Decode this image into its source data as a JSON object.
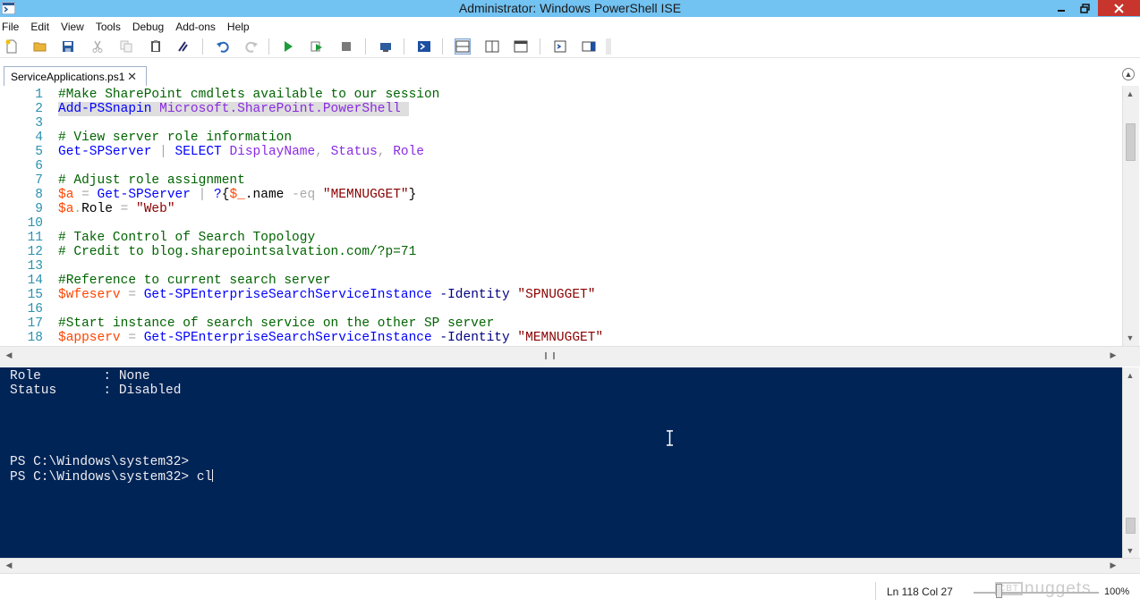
{
  "window": {
    "title": "Administrator: Windows PowerShell ISE",
    "icons": {
      "app": "powershell-ise-icon",
      "minimize": "minimize-icon",
      "maximize": "restore-icon",
      "close": "close-icon"
    }
  },
  "menubar": {
    "items": [
      "File",
      "Edit",
      "View",
      "Tools",
      "Debug",
      "Add-ons",
      "Help"
    ]
  },
  "toolbar": {
    "buttons": [
      "new-file-icon",
      "open-icon",
      "save-icon",
      "cut-icon",
      "copy-icon",
      "paste-icon",
      "clear-console-icon",
      "undo-icon",
      "redo-icon",
      "run-script-icon",
      "run-selection-icon",
      "stop-icon",
      "new-remote-tab-icon",
      "start-powershell-icon",
      "show-script-top-icon",
      "show-script-right-icon",
      "show-script-maximized-icon",
      "show-command-window-icon",
      "show-command-addon-icon"
    ]
  },
  "tabs": [
    {
      "label": "ServiceApplications.ps1",
      "close": "✕",
      "active": true
    }
  ],
  "editor": {
    "line_numbers": [
      "1",
      "2",
      "3",
      "4",
      "5",
      "6",
      "7",
      "8",
      "9",
      "10",
      "11",
      "12",
      "13",
      "14",
      "15",
      "16",
      "17",
      "18"
    ],
    "lines": [
      [
        {
          "t": "#Make SharePoint cmdlets available to our session",
          "c": "comment"
        }
      ],
      [
        {
          "t": "Add-PSSnapin",
          "c": "cmd",
          "sel": true
        },
        {
          "t": " ",
          "c": "plain",
          "sel": true
        },
        {
          "t": "Microsoft.SharePoint.PowerShell",
          "c": "arg",
          "sel": true
        },
        {
          "t": " ",
          "c": "plain",
          "sel": true
        }
      ],
      [],
      [
        {
          "t": "# View server role information",
          "c": "comment"
        }
      ],
      [
        {
          "t": "Get-SPServer",
          "c": "cmd"
        },
        {
          "t": " ",
          "c": "plain"
        },
        {
          "t": "|",
          "c": "op"
        },
        {
          "t": " ",
          "c": "plain"
        },
        {
          "t": "SELECT",
          "c": "cmd"
        },
        {
          "t": " ",
          "c": "plain"
        },
        {
          "t": "DisplayName",
          "c": "arg"
        },
        {
          "t": ",",
          "c": "op"
        },
        {
          "t": " ",
          "c": "plain"
        },
        {
          "t": "Status",
          "c": "arg"
        },
        {
          "t": ",",
          "c": "op"
        },
        {
          "t": " ",
          "c": "plain"
        },
        {
          "t": "Role",
          "c": "arg"
        }
      ],
      [],
      [
        {
          "t": "# Adjust role assignment",
          "c": "comment"
        }
      ],
      [
        {
          "t": "$a",
          "c": "var"
        },
        {
          "t": " ",
          "c": "plain"
        },
        {
          "t": "=",
          "c": "op"
        },
        {
          "t": " ",
          "c": "plain"
        },
        {
          "t": "Get-SPServer",
          "c": "cmd"
        },
        {
          "t": " ",
          "c": "plain"
        },
        {
          "t": "|",
          "c": "op"
        },
        {
          "t": " ",
          "c": "plain"
        },
        {
          "t": "?",
          "c": "cmd"
        },
        {
          "t": "{",
          "c": "plain"
        },
        {
          "t": "$_",
          "c": "var"
        },
        {
          "t": ".name",
          "c": "plain"
        },
        {
          "t": " ",
          "c": "plain"
        },
        {
          "t": "-eq",
          "c": "op"
        },
        {
          "t": " ",
          "c": "plain"
        },
        {
          "t": "\"MEMNUGGET\"",
          "c": "str"
        },
        {
          "t": "}",
          "c": "plain"
        }
      ],
      [
        {
          "t": "$a",
          "c": "var"
        },
        {
          "t": ".",
          "c": "op"
        },
        {
          "t": "Role",
          "c": "plain"
        },
        {
          "t": " ",
          "c": "plain"
        },
        {
          "t": "=",
          "c": "op"
        },
        {
          "t": " ",
          "c": "plain"
        },
        {
          "t": "\"Web\"",
          "c": "str"
        }
      ],
      [],
      [
        {
          "t": "# Take Control of Search Topology",
          "c": "comment"
        }
      ],
      [
        {
          "t": "# Credit to blog.sharepointsalvation.com/?p=71",
          "c": "comment"
        }
      ],
      [],
      [
        {
          "t": "#Reference to current search server",
          "c": "comment"
        }
      ],
      [
        {
          "t": "$wfeserv",
          "c": "var"
        },
        {
          "t": " ",
          "c": "plain"
        },
        {
          "t": "=",
          "c": "op"
        },
        {
          "t": " ",
          "c": "plain"
        },
        {
          "t": "Get-SPEnterpriseSearchServiceInstance",
          "c": "cmd"
        },
        {
          "t": " ",
          "c": "plain"
        },
        {
          "t": "-Identity",
          "c": "param"
        },
        {
          "t": " ",
          "c": "plain"
        },
        {
          "t": "\"SPNUGGET\"",
          "c": "str"
        }
      ],
      [],
      [
        {
          "t": "#Start instance of search service on the other SP server",
          "c": "comment"
        }
      ],
      [
        {
          "t": "$appserv",
          "c": "var"
        },
        {
          "t": " ",
          "c": "plain"
        },
        {
          "t": "=",
          "c": "op"
        },
        {
          "t": " ",
          "c": "plain"
        },
        {
          "t": "Get-SPEnterpriseSearchServiceInstance",
          "c": "cmd"
        },
        {
          "t": " ",
          "c": "plain"
        },
        {
          "t": "-Identity",
          "c": "param"
        },
        {
          "t": " ",
          "c": "plain"
        },
        {
          "t": "\"MEMNUGGET\"",
          "c": "str"
        }
      ]
    ]
  },
  "console": {
    "lines": [
      "Role        : None",
      "Status      : Disabled",
      "",
      "",
      "",
      "",
      "PS C:\\Windows\\system32>",
      "PS C:\\Windows\\system32> cl"
    ]
  },
  "statusbar": {
    "position": "Ln 118  Col 27",
    "zoom": "100%",
    "zoom_level": 100,
    "watermark_badge": "CBT",
    "watermark_text": "nuggets"
  },
  "colors": {
    "titlebar": "#72c2f2",
    "console_bg": "#012456",
    "console_fg": "#eeedf0",
    "comment": "#006400",
    "command": "#0000ff",
    "argument": "#8a2be2",
    "string": "#8b0000",
    "variable": "#ff4500"
  }
}
